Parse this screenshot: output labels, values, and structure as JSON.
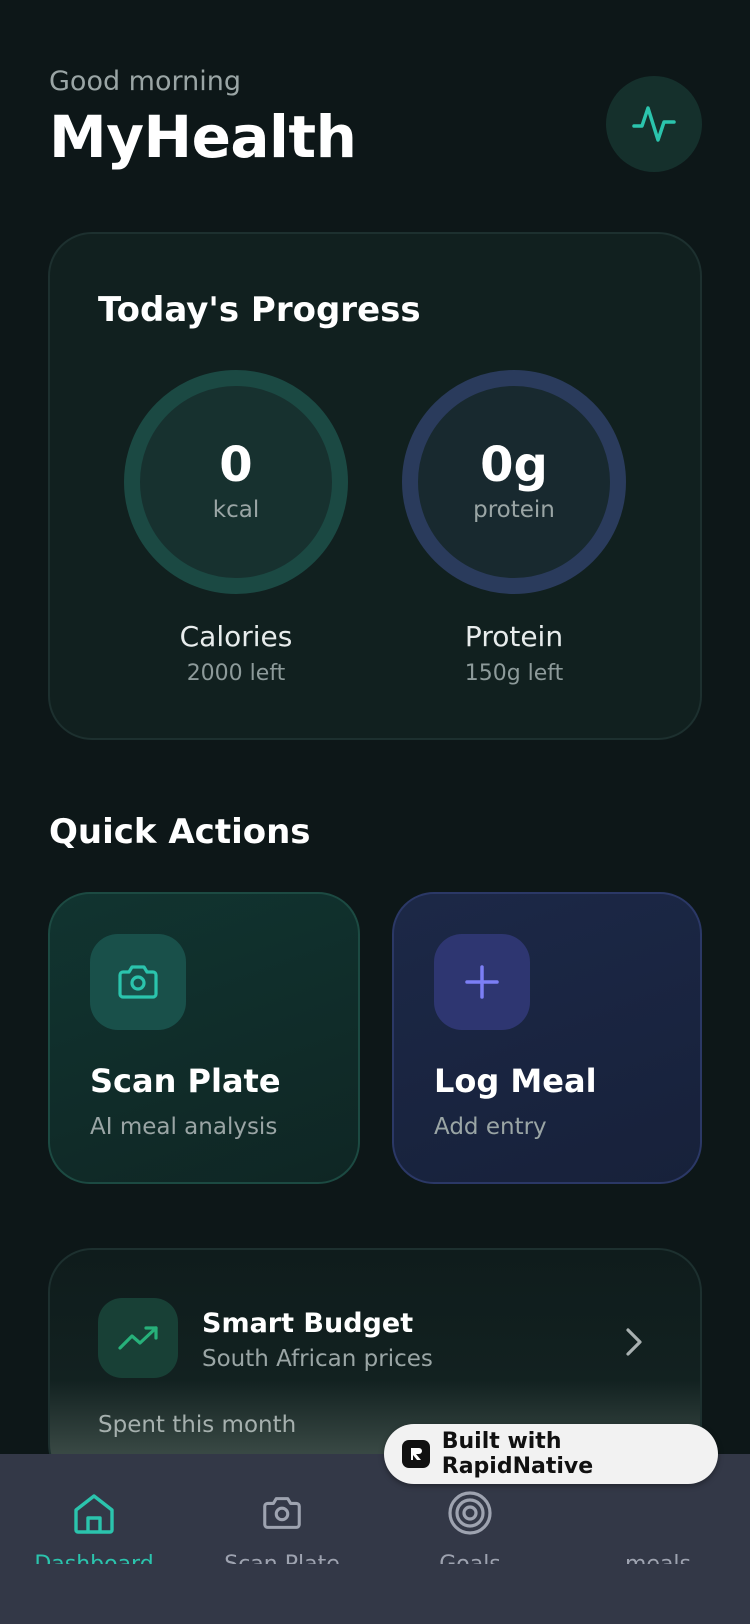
{
  "header": {
    "greeting": "Good morning",
    "title": "MyHealth",
    "pulse_icon": "activity-pulse-icon"
  },
  "progress": {
    "title": "Today's Progress",
    "calories": {
      "value": "0",
      "unit": "kcal",
      "label": "Calories",
      "remaining": "2000 left",
      "fraction": 0
    },
    "protein": {
      "value": "0g",
      "unit": "protein",
      "label": "Protein",
      "remaining": "150g left",
      "fraction": 0
    }
  },
  "quick_actions": {
    "title": "Quick Actions",
    "items": [
      {
        "title": "Scan Plate",
        "subtitle": "AI meal analysis",
        "icon": "camera-icon"
      },
      {
        "title": "Log Meal",
        "subtitle": "Add entry",
        "icon": "plus-icon"
      }
    ]
  },
  "budget": {
    "title": "Smart Budget",
    "subtitle": "South African prices",
    "spent_label": "Spent this month",
    "icon": "trending-up-icon"
  },
  "tabbar": {
    "tabs": [
      {
        "label": "Dashboard",
        "icon": "home-icon",
        "active": true
      },
      {
        "label": "Scan Plate",
        "icon": "camera-icon",
        "active": false
      },
      {
        "label": "Goals",
        "icon": "target-icon",
        "active": false
      },
      {
        "label": "meals",
        "icon": "",
        "active": false
      }
    ]
  },
  "badge": {
    "text": "Built with RapidNative"
  },
  "colors": {
    "background": "#0d1718",
    "accent_teal": "#2bc4ad",
    "accent_indigo": "#6b6ff0",
    "tab_bar": "#333847"
  }
}
